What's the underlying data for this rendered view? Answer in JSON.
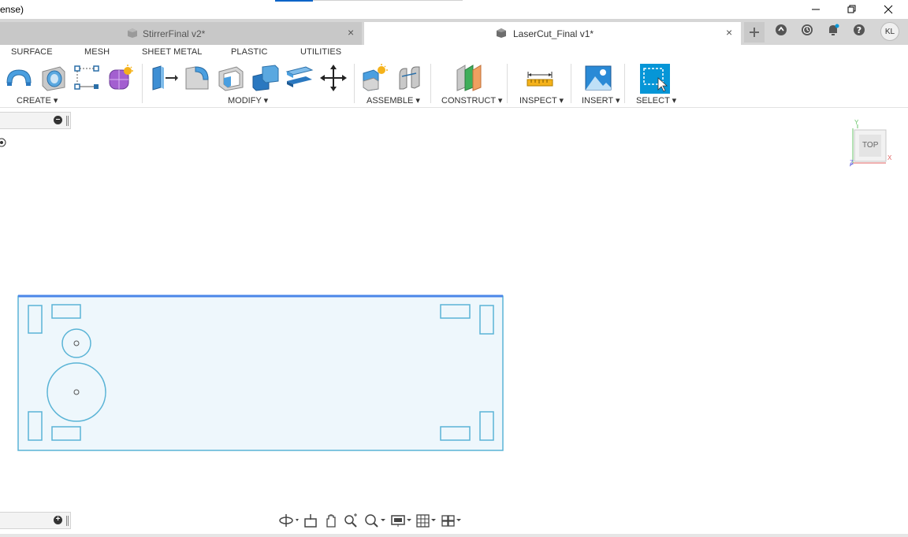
{
  "window": {
    "title": "ense)",
    "minimize_glyph": "—",
    "restore_glyph": "❐",
    "close_glyph": "✕"
  },
  "tabs": [
    {
      "label": "StirrerFinal v2*",
      "active": false,
      "close": "×"
    },
    {
      "label": "LaserCut_Final v1*",
      "active": true,
      "close": "×"
    }
  ],
  "tab_actions": {
    "new_tab_icon": "plus-icon",
    "icons": [
      "extensions-icon",
      "job-status-icon",
      "notifications-icon",
      "help-icon"
    ],
    "avatar": "KL"
  },
  "workspace_tabs": [
    "SURFACE",
    "MESH",
    "SHEET METAL",
    "PLASTIC",
    "UTILITIES"
  ],
  "toolbar": {
    "groups": [
      {
        "label": "CREATE ▾",
        "tools": [
          "sweep-icon",
          "hole-icon",
          "sketch-pattern-icon",
          "form-icon"
        ]
      },
      {
        "label": "MODIFY ▾",
        "tools": [
          "press-pull-icon",
          "fillet-icon",
          "shell-icon",
          "combine-icon",
          "offset-face-icon",
          "move-icon"
        ]
      },
      {
        "label": "ASSEMBLE ▾",
        "tools": [
          "new-component-icon",
          "joint-icon"
        ]
      },
      {
        "label": "CONSTRUCT ▾",
        "tools": [
          "offset-plane-icon"
        ]
      },
      {
        "label": "INSPECT ▾",
        "tools": [
          "measure-icon"
        ]
      },
      {
        "label": "INSERT ▾",
        "tools": [
          "insert-image-icon"
        ]
      },
      {
        "label": "SELECT ▾",
        "tools": [
          "select-icon"
        ]
      }
    ]
  },
  "viewcube": {
    "face": "TOP",
    "axis_y": "Y",
    "axis_x": "X",
    "axis_z": "Z"
  },
  "colors": {
    "accent": "#0696d7",
    "sketch_line": "#5ab4d6",
    "edge_highlight": "#4a86e8",
    "plate_fill": "#eef7fc"
  },
  "navbar": {
    "icons": [
      "orbit-icon",
      "look-at-icon",
      "pan-icon",
      "zoom-icon",
      "zoom-window-icon",
      "display-settings-icon",
      "grid-settings-icon",
      "viewports-icon"
    ]
  }
}
